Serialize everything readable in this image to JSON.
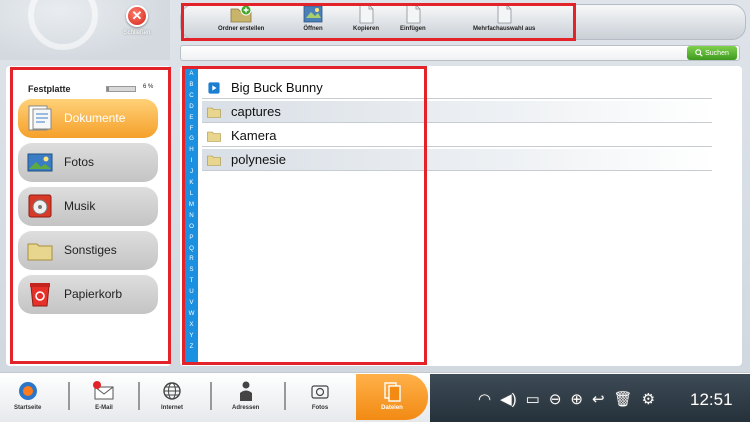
{
  "header": {
    "close_label": "Schließen"
  },
  "toolbar": {
    "items": [
      {
        "label": "Ordner erstellen",
        "icon": "folder-add-icon"
      },
      {
        "label": "Öffnen",
        "icon": "open-icon"
      },
      {
        "label": "Kopieren",
        "icon": "copy-icon"
      },
      {
        "label": "Einfügen",
        "icon": "paste-icon"
      },
      {
        "label": "Mehrfachauswahl aus",
        "icon": "multi-select-icon"
      }
    ]
  },
  "search": {
    "placeholder": "",
    "button_label": "Suchen"
  },
  "sidebar": {
    "disk_label": "Festplatte",
    "disk_usage_percent": 6,
    "disk_usage_text": "6 %",
    "items": [
      {
        "label": "Dokumente",
        "icon": "documents-icon",
        "active": true
      },
      {
        "label": "Fotos",
        "icon": "photos-icon",
        "active": false
      },
      {
        "label": "Musik",
        "icon": "music-icon",
        "active": false
      },
      {
        "label": "Sonstiges",
        "icon": "folder-icon",
        "active": false
      },
      {
        "label": "Papierkorb",
        "icon": "trash-icon",
        "active": false
      }
    ]
  },
  "alphabet": [
    "A",
    "B",
    "C",
    "D",
    "E",
    "F",
    "G",
    "H",
    "I",
    "J",
    "K",
    "L",
    "M",
    "N",
    "O",
    "P",
    "Q",
    "R",
    "S",
    "T",
    "U",
    "V",
    "W",
    "X",
    "Y",
    "Z"
  ],
  "files": [
    {
      "name": "Big Buck Bunny",
      "icon": "video-icon"
    },
    {
      "name": "captures",
      "icon": "folder-icon"
    },
    {
      "name": "Kamera",
      "icon": "folder-icon"
    },
    {
      "name": "polynesie",
      "icon": "folder-icon"
    }
  ],
  "taskbar": {
    "items": [
      {
        "label": "Startseite",
        "icon": "home-icon"
      },
      {
        "label": "E-Mail",
        "icon": "email-icon"
      },
      {
        "label": "Internet",
        "icon": "globe-icon"
      },
      {
        "label": "Adressen",
        "icon": "contacts-icon"
      },
      {
        "label": "Fotos",
        "icon": "camera-icon"
      },
      {
        "label": "Dateien",
        "icon": "files-icon"
      }
    ],
    "clock": "12:51"
  },
  "colors": {
    "highlight": "#e2232a",
    "active_orange": "#f5a02a",
    "alpha_blue": "#1b8fe0"
  }
}
